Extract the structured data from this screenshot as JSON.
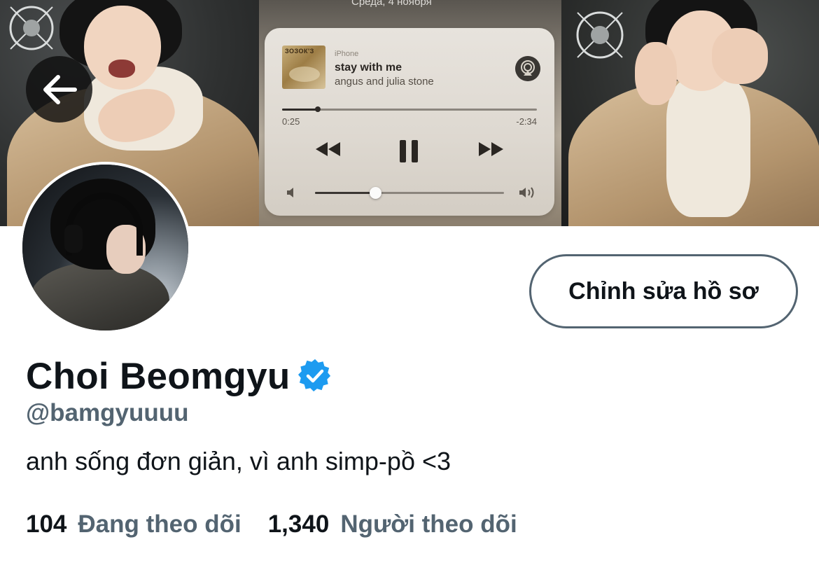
{
  "banner": {
    "caption": "Среда, 4 ноября",
    "player": {
      "device": "iPhone",
      "album_art_text": "ЗОЗОК'З",
      "track": "stay with me",
      "artist": "angus and julia stone",
      "elapsed": "0:25",
      "remaining": "-2:34",
      "progress": 0.14,
      "volume": 0.32
    }
  },
  "navigation": {
    "back_icon": "arrow-left-icon"
  },
  "profile": {
    "edit_button": "Chỉnh sửa hồ sơ",
    "name": "Choi Beomgyu",
    "verified_icon": "verified-badge-icon",
    "verified_color": "#1d9bf0",
    "handle": "@bamgyuuuu",
    "bio": "anh sống đơn giản, vì anh simp-pồ <3",
    "following_count": "104",
    "following_label": "Đang theo dõi",
    "followers_count": "1,340",
    "followers_label": "Người theo dõi"
  },
  "colors": {
    "text_primary": "#0f1419",
    "text_secondary": "#536471",
    "background": "#ffffff"
  }
}
